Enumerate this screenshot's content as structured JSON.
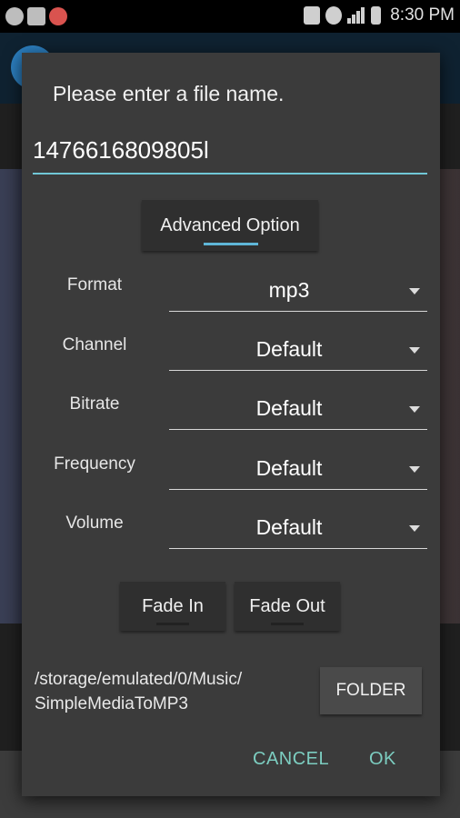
{
  "status_bar": {
    "time": "8:30 PM",
    "left_icons": [
      "sync-icon",
      "image-icon",
      "record-icon"
    ],
    "right_icons": [
      "vibrate-icon",
      "settings-icon",
      "signal-icon",
      "battery-icon"
    ]
  },
  "dialog": {
    "title": "Please enter a file name.",
    "filename_value": "1476616809805l",
    "advanced_option_label": "Advanced Option",
    "options": [
      {
        "label": "Format",
        "value": "mp3"
      },
      {
        "label": "Channel",
        "value": "Default"
      },
      {
        "label": "Bitrate",
        "value": "Default"
      },
      {
        "label": "Frequency",
        "value": "Default"
      },
      {
        "label": "Volume",
        "value": "Default"
      }
    ],
    "fade_in_label": "Fade In",
    "fade_out_label": "Fade Out",
    "save_path": "/storage/emulated/0/Music/\nSimpleMediaToMP3",
    "folder_label": "FOLDER",
    "cancel_label": "CANCEL",
    "ok_label": "OK"
  },
  "colors": {
    "accent": "#70c7d6",
    "action_text": "#7ccdc0",
    "dialog_bg": "#3b3b3b"
  }
}
